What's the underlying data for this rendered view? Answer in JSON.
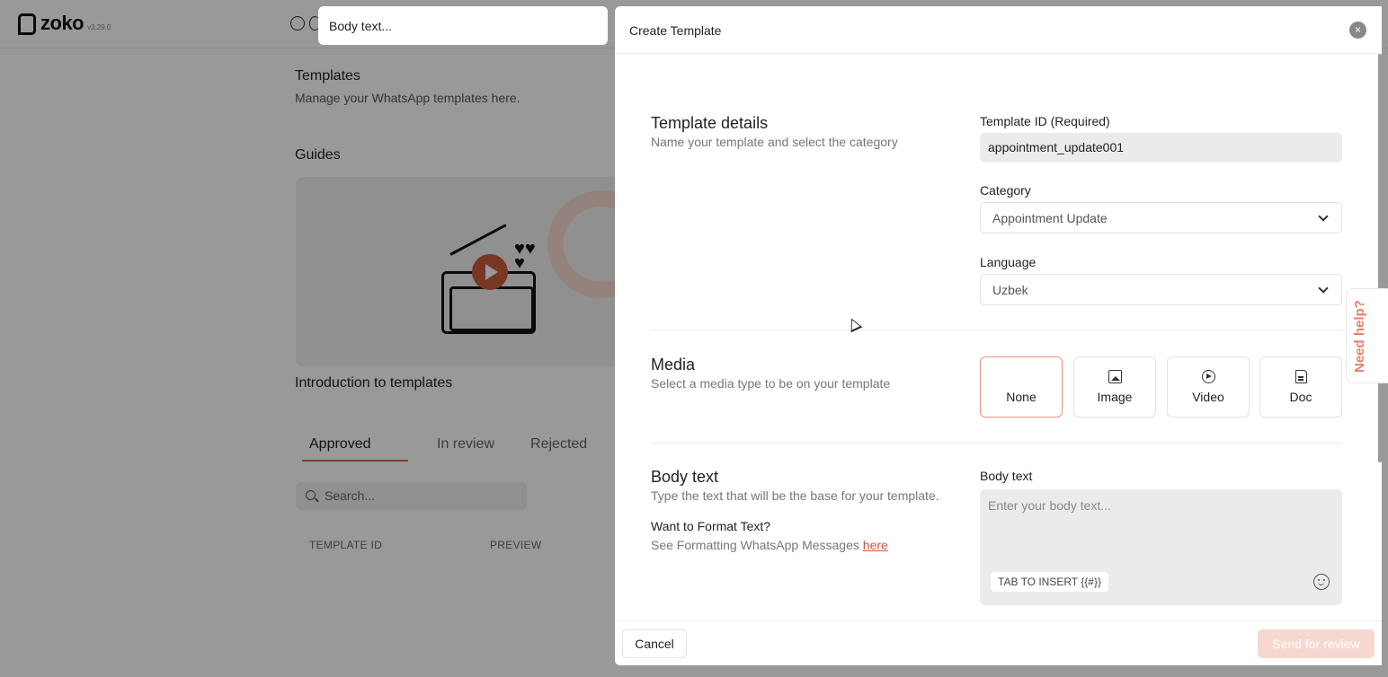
{
  "app": {
    "logo_text": "zoko",
    "version": "v3.29.0"
  },
  "background": {
    "title": "Templates",
    "subtitle": "Manage your WhatsApp templates here.",
    "guides_heading": "Guides",
    "guide_title": "Introduction to templates",
    "tabs": [
      "Approved",
      "In review",
      "Rejected"
    ],
    "search_placeholder": "Search...",
    "columns": [
      "TEMPLATE ID",
      "PREVIEW"
    ]
  },
  "preview_pill": {
    "text": "Body text..."
  },
  "drawer": {
    "title": "Create Template",
    "close_label": "×",
    "template_details": {
      "title": "Template details",
      "subtitle": "Name your template and select the category"
    },
    "template_id": {
      "label": "Template ID (Required)",
      "value": "appointment_update001"
    },
    "category": {
      "label": "Category",
      "value": "Appointment Update"
    },
    "language": {
      "label": "Language",
      "value": "Uzbek"
    },
    "media": {
      "title": "Media",
      "subtitle": "Select a media type to be on your template",
      "options": [
        "None",
        "Image",
        "Video",
        "Doc"
      ],
      "selected": "None"
    },
    "body": {
      "title": "Body text",
      "subtitle": "Type the text that will be the base for your template.",
      "format_question": "Want to Format Text?",
      "format_prefix": "See Formatting WhatsApp Messages ",
      "format_link": "here",
      "field_label": "Body text",
      "placeholder": "Enter your body text...",
      "tab_insert": "TAB TO INSERT {{#}}"
    },
    "footer": {
      "cancel": "Cancel",
      "send": "Send for review"
    }
  },
  "help": {
    "label": "Need help?"
  },
  "colors": {
    "accent": "#d0553a",
    "selected_border": "#e29580",
    "send_disabled": "#f7d8d0"
  }
}
